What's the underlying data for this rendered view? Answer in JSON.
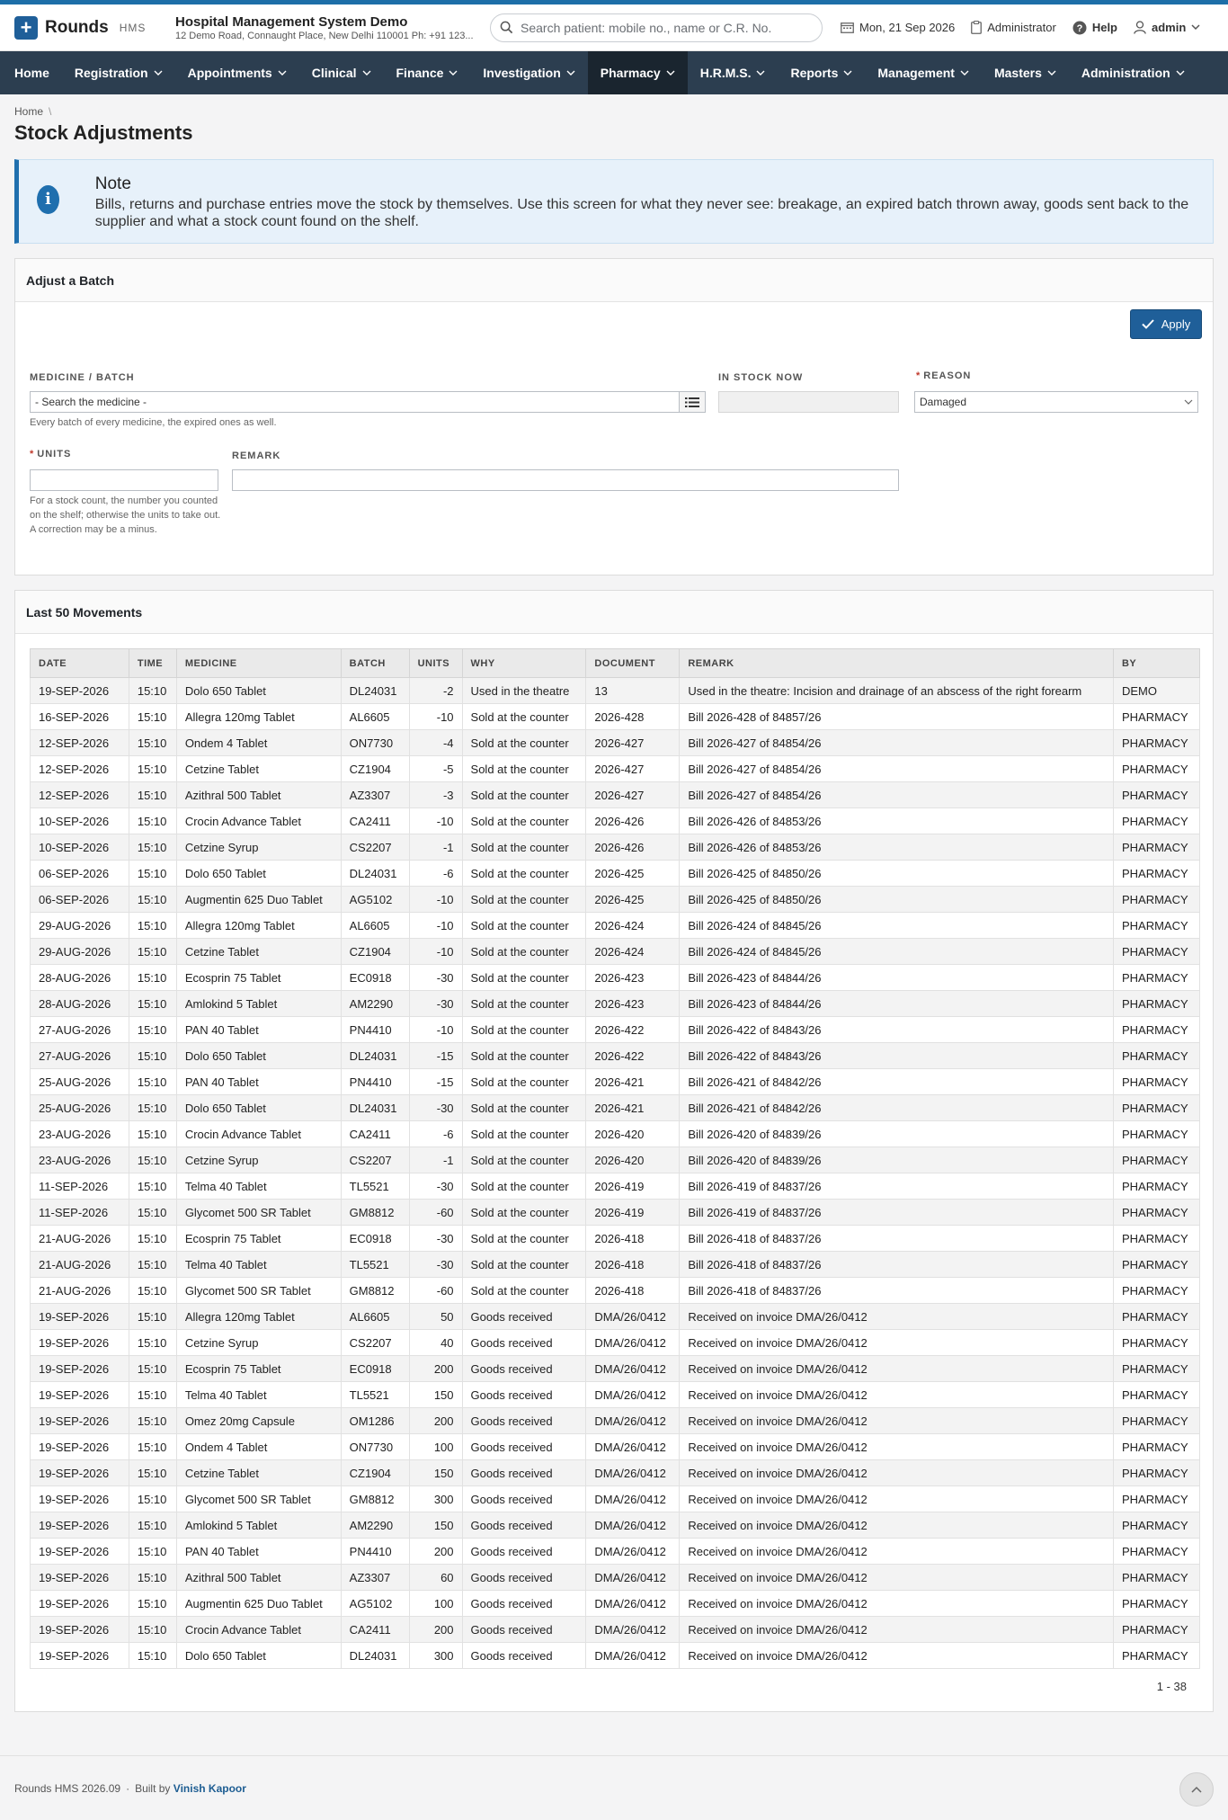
{
  "brand": {
    "name": "Rounds",
    "sub": "HMS"
  },
  "hospital": {
    "name": "Hospital Management System Demo",
    "address": "12 Demo Road, Connaught Place, New Delhi 110001 Ph: +91 123..."
  },
  "search": {
    "placeholder": "Search patient: mobile no., name or C.R. No."
  },
  "header": {
    "date": "Mon, 21 Sep 2026",
    "role": "Administrator",
    "help": "Help",
    "user": "admin"
  },
  "nav": [
    {
      "label": "Home",
      "has_menu": false
    },
    {
      "label": "Registration",
      "has_menu": true
    },
    {
      "label": "Appointments",
      "has_menu": true
    },
    {
      "label": "Clinical",
      "has_menu": true
    },
    {
      "label": "Finance",
      "has_menu": true
    },
    {
      "label": "Investigation",
      "has_menu": true
    },
    {
      "label": "Pharmacy",
      "has_menu": true,
      "active": true
    },
    {
      "label": "H.R.M.S.",
      "has_menu": true
    },
    {
      "label": "Reports",
      "has_menu": true
    },
    {
      "label": "Management",
      "has_menu": true
    },
    {
      "label": "Masters",
      "has_menu": true
    },
    {
      "label": "Administration",
      "has_menu": true
    }
  ],
  "breadcrumb": {
    "home": "Home",
    "separator": "\\"
  },
  "page_title": "Stock Adjustments",
  "note": {
    "title": "Note",
    "text": "Bills, returns and purchase entries move the stock by themselves. Use this screen for what they never see: breakage, an expired batch thrown away, goods sent back to the supplier and what a stock count found on the shelf."
  },
  "form": {
    "title": "Adjust a Batch",
    "apply_label": "Apply",
    "medicine_label": "MEDICINE / BATCH",
    "medicine_value": "- Search the medicine -",
    "medicine_help": "Every batch of every medicine, the expired ones as well.",
    "in_stock_label": "IN STOCK NOW",
    "in_stock_value": "",
    "reason_label": "REASON",
    "reason_value": "Damaged",
    "units_label": "UNITS",
    "units_value": "",
    "units_help": "For a stock count, the number you counted on the shelf; otherwise the units to take out. A correction may be a minus.",
    "remark_label": "REMARK",
    "remark_value": ""
  },
  "movements": {
    "title": "Last 50 Movements",
    "columns": [
      "DATE",
      "TIME",
      "MEDICINE",
      "BATCH",
      "UNITS",
      "WHY",
      "DOCUMENT",
      "REMARK",
      "BY"
    ],
    "rows": [
      [
        "19-SEP-2026",
        "15:10",
        "Dolo 650 Tablet",
        "DL24031",
        "-2",
        "Used in the theatre",
        "13",
        "Used in the theatre: Incision and drainage of an abscess of the right forearm",
        "DEMO"
      ],
      [
        "16-SEP-2026",
        "15:10",
        "Allegra 120mg Tablet",
        "AL6605",
        "-10",
        "Sold at the counter",
        "2026-428",
        "Bill 2026-428 of 84857/26",
        "PHARMACY"
      ],
      [
        "12-SEP-2026",
        "15:10",
        "Ondem 4 Tablet",
        "ON7730",
        "-4",
        "Sold at the counter",
        "2026-427",
        "Bill 2026-427 of 84854/26",
        "PHARMACY"
      ],
      [
        "12-SEP-2026",
        "15:10",
        "Cetzine Tablet",
        "CZ1904",
        "-5",
        "Sold at the counter",
        "2026-427",
        "Bill 2026-427 of 84854/26",
        "PHARMACY"
      ],
      [
        "12-SEP-2026",
        "15:10",
        "Azithral 500 Tablet",
        "AZ3307",
        "-3",
        "Sold at the counter",
        "2026-427",
        "Bill 2026-427 of 84854/26",
        "PHARMACY"
      ],
      [
        "10-SEP-2026",
        "15:10",
        "Crocin Advance Tablet",
        "CA2411",
        "-10",
        "Sold at the counter",
        "2026-426",
        "Bill 2026-426 of 84853/26",
        "PHARMACY"
      ],
      [
        "10-SEP-2026",
        "15:10",
        "Cetzine Syrup",
        "CS2207",
        "-1",
        "Sold at the counter",
        "2026-426",
        "Bill 2026-426 of 84853/26",
        "PHARMACY"
      ],
      [
        "06-SEP-2026",
        "15:10",
        "Dolo 650 Tablet",
        "DL24031",
        "-6",
        "Sold at the counter",
        "2026-425",
        "Bill 2026-425 of 84850/26",
        "PHARMACY"
      ],
      [
        "06-SEP-2026",
        "15:10",
        "Augmentin 625 Duo Tablet",
        "AG5102",
        "-10",
        "Sold at the counter",
        "2026-425",
        "Bill 2026-425 of 84850/26",
        "PHARMACY"
      ],
      [
        "29-AUG-2026",
        "15:10",
        "Allegra 120mg Tablet",
        "AL6605",
        "-10",
        "Sold at the counter",
        "2026-424",
        "Bill 2026-424 of 84845/26",
        "PHARMACY"
      ],
      [
        "29-AUG-2026",
        "15:10",
        "Cetzine Tablet",
        "CZ1904",
        "-10",
        "Sold at the counter",
        "2026-424",
        "Bill 2026-424 of 84845/26",
        "PHARMACY"
      ],
      [
        "28-AUG-2026",
        "15:10",
        "Ecosprin 75 Tablet",
        "EC0918",
        "-30",
        "Sold at the counter",
        "2026-423",
        "Bill 2026-423 of 84844/26",
        "PHARMACY"
      ],
      [
        "28-AUG-2026",
        "15:10",
        "Amlokind 5 Tablet",
        "AM2290",
        "-30",
        "Sold at the counter",
        "2026-423",
        "Bill 2026-423 of 84844/26",
        "PHARMACY"
      ],
      [
        "27-AUG-2026",
        "15:10",
        "PAN 40 Tablet",
        "PN4410",
        "-10",
        "Sold at the counter",
        "2026-422",
        "Bill 2026-422 of 84843/26",
        "PHARMACY"
      ],
      [
        "27-AUG-2026",
        "15:10",
        "Dolo 650 Tablet",
        "DL24031",
        "-15",
        "Sold at the counter",
        "2026-422",
        "Bill 2026-422 of 84843/26",
        "PHARMACY"
      ],
      [
        "25-AUG-2026",
        "15:10",
        "PAN 40 Tablet",
        "PN4410",
        "-15",
        "Sold at the counter",
        "2026-421",
        "Bill 2026-421 of 84842/26",
        "PHARMACY"
      ],
      [
        "25-AUG-2026",
        "15:10",
        "Dolo 650 Tablet",
        "DL24031",
        "-30",
        "Sold at the counter",
        "2026-421",
        "Bill 2026-421 of 84842/26",
        "PHARMACY"
      ],
      [
        "23-AUG-2026",
        "15:10",
        "Crocin Advance Tablet",
        "CA2411",
        "-6",
        "Sold at the counter",
        "2026-420",
        "Bill 2026-420 of 84839/26",
        "PHARMACY"
      ],
      [
        "23-AUG-2026",
        "15:10",
        "Cetzine Syrup",
        "CS2207",
        "-1",
        "Sold at the counter",
        "2026-420",
        "Bill 2026-420 of 84839/26",
        "PHARMACY"
      ],
      [
        "11-SEP-2026",
        "15:10",
        "Telma 40 Tablet",
        "TL5521",
        "-30",
        "Sold at the counter",
        "2026-419",
        "Bill 2026-419 of 84837/26",
        "PHARMACY"
      ],
      [
        "11-SEP-2026",
        "15:10",
        "Glycomet 500 SR Tablet",
        "GM8812",
        "-60",
        "Sold at the counter",
        "2026-419",
        "Bill 2026-419 of 84837/26",
        "PHARMACY"
      ],
      [
        "21-AUG-2026",
        "15:10",
        "Ecosprin 75 Tablet",
        "EC0918",
        "-30",
        "Sold at the counter",
        "2026-418",
        "Bill 2026-418 of 84837/26",
        "PHARMACY"
      ],
      [
        "21-AUG-2026",
        "15:10",
        "Telma 40 Tablet",
        "TL5521",
        "-30",
        "Sold at the counter",
        "2026-418",
        "Bill 2026-418 of 84837/26",
        "PHARMACY"
      ],
      [
        "21-AUG-2026",
        "15:10",
        "Glycomet 500 SR Tablet",
        "GM8812",
        "-60",
        "Sold at the counter",
        "2026-418",
        "Bill 2026-418 of 84837/26",
        "PHARMACY"
      ],
      [
        "19-SEP-2026",
        "15:10",
        "Allegra 120mg Tablet",
        "AL6605",
        "50",
        "Goods received",
        "DMA/26/0412",
        "Received on invoice DMA/26/0412",
        "PHARMACY"
      ],
      [
        "19-SEP-2026",
        "15:10",
        "Cetzine Syrup",
        "CS2207",
        "40",
        "Goods received",
        "DMA/26/0412",
        "Received on invoice DMA/26/0412",
        "PHARMACY"
      ],
      [
        "19-SEP-2026",
        "15:10",
        "Ecosprin 75 Tablet",
        "EC0918",
        "200",
        "Goods received",
        "DMA/26/0412",
        "Received on invoice DMA/26/0412",
        "PHARMACY"
      ],
      [
        "19-SEP-2026",
        "15:10",
        "Telma 40 Tablet",
        "TL5521",
        "150",
        "Goods received",
        "DMA/26/0412",
        "Received on invoice DMA/26/0412",
        "PHARMACY"
      ],
      [
        "19-SEP-2026",
        "15:10",
        "Omez 20mg Capsule",
        "OM1286",
        "200",
        "Goods received",
        "DMA/26/0412",
        "Received on invoice DMA/26/0412",
        "PHARMACY"
      ],
      [
        "19-SEP-2026",
        "15:10",
        "Ondem 4 Tablet",
        "ON7730",
        "100",
        "Goods received",
        "DMA/26/0412",
        "Received on invoice DMA/26/0412",
        "PHARMACY"
      ],
      [
        "19-SEP-2026",
        "15:10",
        "Cetzine Tablet",
        "CZ1904",
        "150",
        "Goods received",
        "DMA/26/0412",
        "Received on invoice DMA/26/0412",
        "PHARMACY"
      ],
      [
        "19-SEP-2026",
        "15:10",
        "Glycomet 500 SR Tablet",
        "GM8812",
        "300",
        "Goods received",
        "DMA/26/0412",
        "Received on invoice DMA/26/0412",
        "PHARMACY"
      ],
      [
        "19-SEP-2026",
        "15:10",
        "Amlokind 5 Tablet",
        "AM2290",
        "150",
        "Goods received",
        "DMA/26/0412",
        "Received on invoice DMA/26/0412",
        "PHARMACY"
      ],
      [
        "19-SEP-2026",
        "15:10",
        "PAN 40 Tablet",
        "PN4410",
        "200",
        "Goods received",
        "DMA/26/0412",
        "Received on invoice DMA/26/0412",
        "PHARMACY"
      ],
      [
        "19-SEP-2026",
        "15:10",
        "Azithral 500 Tablet",
        "AZ3307",
        "60",
        "Goods received",
        "DMA/26/0412",
        "Received on invoice DMA/26/0412",
        "PHARMACY"
      ],
      [
        "19-SEP-2026",
        "15:10",
        "Augmentin 625 Duo Tablet",
        "AG5102",
        "100",
        "Goods received",
        "DMA/26/0412",
        "Received on invoice DMA/26/0412",
        "PHARMACY"
      ],
      [
        "19-SEP-2026",
        "15:10",
        "Crocin Advance Tablet",
        "CA2411",
        "200",
        "Goods received",
        "DMA/26/0412",
        "Received on invoice DMA/26/0412",
        "PHARMACY"
      ],
      [
        "19-SEP-2026",
        "15:10",
        "Dolo 650 Tablet",
        "DL24031",
        "300",
        "Goods received",
        "DMA/26/0412",
        "Received on invoice DMA/26/0412",
        "PHARMACY"
      ]
    ],
    "pager": "1 - 38"
  },
  "footer": {
    "version": "Rounds HMS 2026.09",
    "dot": "·",
    "built_by": "Built by",
    "author": "Vinish Kapoor"
  },
  "icons": {
    "brand": "plus-icon",
    "search": "search-icon",
    "date": "calendar-icon",
    "role": "clipboard-icon",
    "help": "help-icon",
    "user": "user-icon",
    "note": "info-icon",
    "apply": "check-icon",
    "list": "list-icon",
    "select": "chevron-down-icon",
    "top": "chevron-up-icon"
  },
  "colors": {
    "accent": "#1f5f99",
    "navbar": "#2c3e50",
    "nav_active": "#1a252f",
    "note_border": "#1f6fae",
    "required": "#c0392b"
  }
}
